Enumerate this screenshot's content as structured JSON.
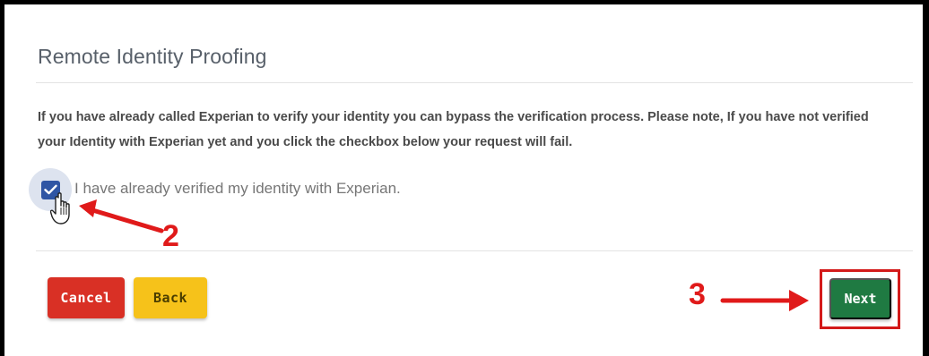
{
  "page": {
    "title": "Remote Identity Proofing",
    "notice": "If you have already called Experian to verify your identity you can bypass the verification process. Please note, If you have not verified your Identity with Experian yet and you click the checkbox below your request will fail."
  },
  "checkbox": {
    "label": "I have already verified my identity with Experian.",
    "checked": true
  },
  "buttons": {
    "cancel": "Cancel",
    "back": "Back",
    "next": "Next"
  },
  "annotations": {
    "step_checkbox": "2",
    "step_next": "3"
  },
  "colors": {
    "cancel": "#d93025",
    "back": "#f6c21a",
    "next": "#1f7a42",
    "checkbox": "#2f55a4",
    "annotation": "#e01a1a"
  },
  "icons": {
    "checkbox_mark": "checkmark-icon",
    "cursor": "hand-pointer-icon",
    "arrows": "arrow-icon"
  }
}
